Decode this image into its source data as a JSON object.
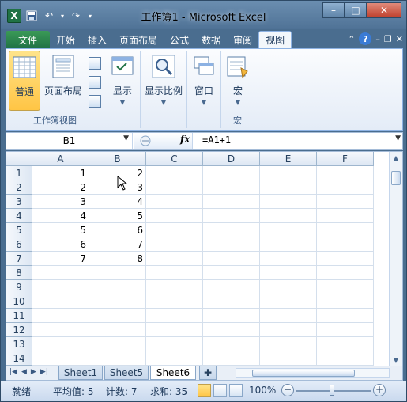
{
  "window": {
    "title": "工作簿1 - Microsoft Excel",
    "controls": {
      "minimize": "–",
      "maximize": "□",
      "close": "✕"
    }
  },
  "qat": {
    "app_icon": "X",
    "save_icon": "save-icon",
    "undo_icon": "undo-icon",
    "redo_icon": "redo-icon"
  },
  "tabs": {
    "file": "文件",
    "items": [
      "开始",
      "插入",
      "页面布局",
      "公式",
      "数据",
      "审阅",
      "视图"
    ],
    "active": "视图"
  },
  "ribbon": {
    "normal_label": "普通",
    "page_layout_label": "页面布局",
    "group_workbook_views": "工作簿视图",
    "show_label": "显示",
    "zoom_label": "显示比例",
    "window_label": "窗口",
    "macro_label": "宏",
    "group_macro": "宏"
  },
  "formula_bar": {
    "name_box": "B1",
    "fx": "fx",
    "formula": "=A1+1"
  },
  "columns": [
    "A",
    "B",
    "C",
    "D",
    "E",
    "F"
  ],
  "rows": [
    "1",
    "2",
    "3",
    "4",
    "5",
    "6",
    "7",
    "8",
    "9",
    "10",
    "11",
    "12",
    "13",
    "14"
  ],
  "cells": {
    "A": [
      "1",
      "2",
      "3",
      "4",
      "5",
      "6",
      "7"
    ],
    "B": [
      "2",
      "3",
      "4",
      "5",
      "6",
      "7",
      "8"
    ]
  },
  "sheet_tabs": [
    "Sheet1",
    "Sheet5",
    "Sheet6"
  ],
  "active_sheet": "Sheet6",
  "status": {
    "ready": "就绪",
    "average": "平均值: 5",
    "count": "计数: 7",
    "sum": "求和: 35",
    "zoom": "100%"
  },
  "colors": {
    "excel_green": "#207245",
    "ribbon_blue": "#8db2e3",
    "active_view": "#ffc545"
  }
}
